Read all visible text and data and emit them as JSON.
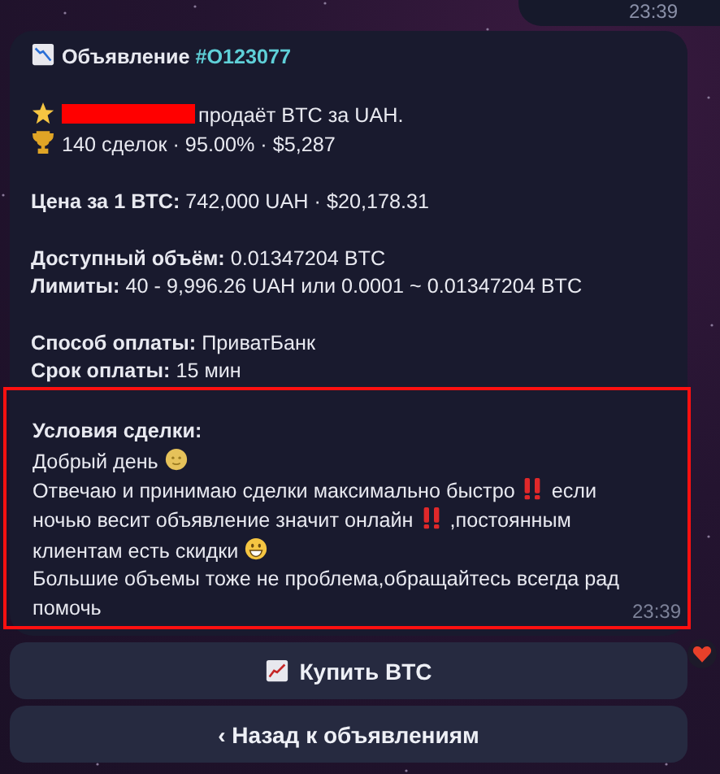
{
  "previous_message": {
    "time": "23:39"
  },
  "message": {
    "title": "Объявление",
    "order_id": "#O123077",
    "seller_line": "продаёт BTC за UAH.",
    "stats": "140 сделок · 95.00% · $5,287",
    "field_groups": [
      [
        {
          "label": "Цена за 1 BTC:",
          "value": "742,000 UAH · $20,178.31"
        }
      ],
      [
        {
          "label": "Доступный объём:",
          "value": "0.01347204 BTC"
        },
        {
          "label": "Лимиты:",
          "value": "40 - 9,996.26 UAH или 0.0001 ~ 0.01347204 BTC"
        }
      ],
      [
        {
          "label": "Способ оплаты:",
          "value": "ПриватБанк"
        },
        {
          "label": "Срок оплаты:",
          "value": "15 мин"
        }
      ]
    ],
    "conditions": {
      "label": "Условия сделки:",
      "lines": [
        [
          "Добрый день"
        ],
        [
          "Отвечаю и принимаю сделки максимально быстро",
          "если"
        ],
        [
          "ночью весит объявление значит онлайн",
          ",постоянным"
        ],
        [
          "клиентам есть скидки"
        ],
        [
          "Большие объемы тоже не проблема,обращайтесь всегда рад"
        ],
        [
          "помочь"
        ]
      ]
    },
    "time": "23:39"
  },
  "buttons": [
    {
      "label": "Купить BTC",
      "kind": "buy"
    },
    {
      "label": "‹ Назад к объявлениям",
      "kind": "back"
    }
  ]
}
